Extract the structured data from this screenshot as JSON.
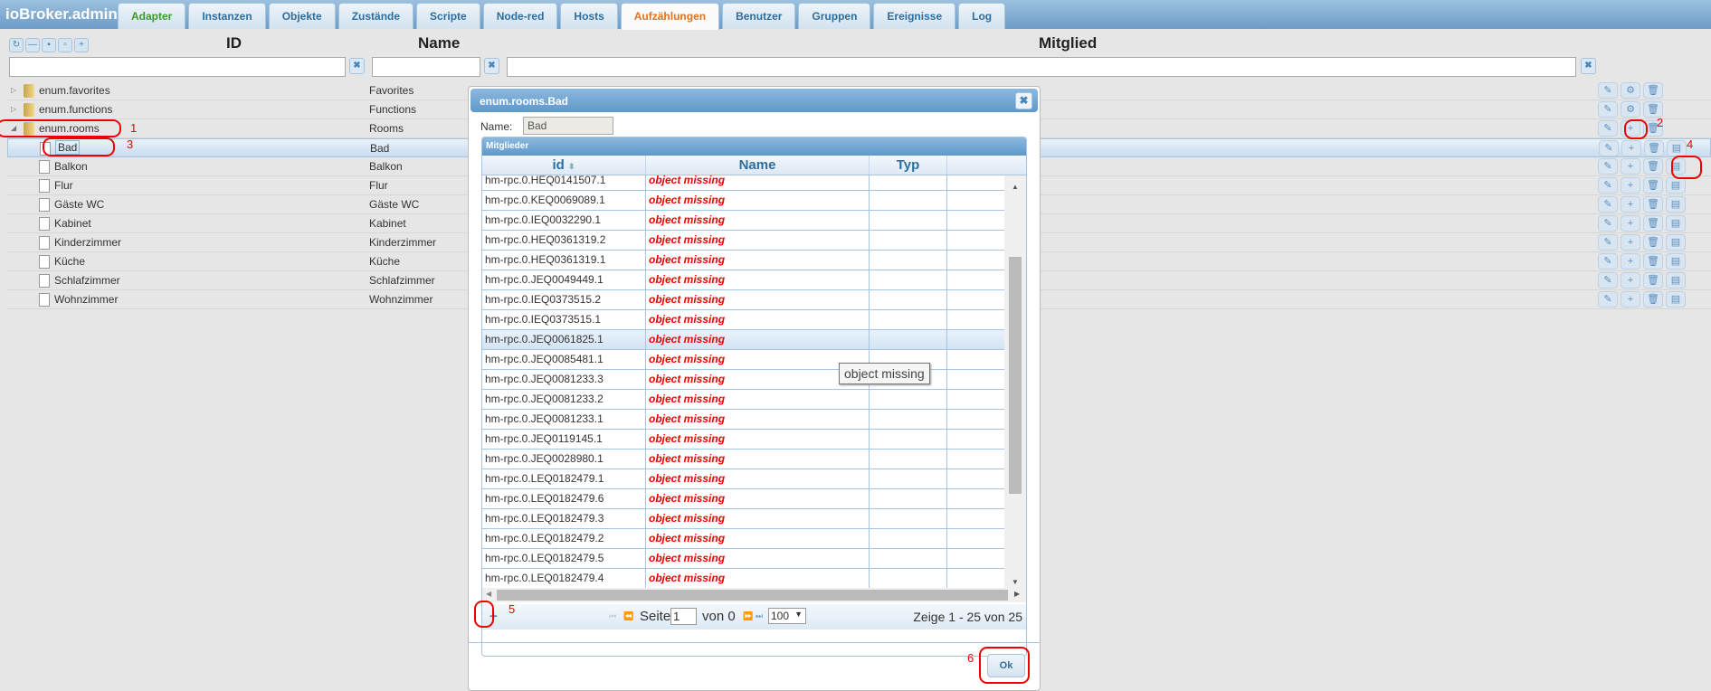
{
  "app": {
    "title": "ioBroker.admin"
  },
  "tabs": [
    "Adapter",
    "Instanzen",
    "Objekte",
    "Zustände",
    "Scripte",
    "Node-red",
    "Hosts",
    "Aufzählungen",
    "Benutzer",
    "Gruppen",
    "Ereignisse",
    "Log"
  ],
  "columns": {
    "id": "ID",
    "name": "Name",
    "members": "Mitglied"
  },
  "tree": [
    {
      "id": "enum.favorites",
      "name": "Favorites",
      "type": "folder",
      "toggle": "▷"
    },
    {
      "id": "enum.functions",
      "name": "Functions",
      "type": "folder",
      "toggle": "▷"
    },
    {
      "id": "enum.rooms",
      "name": "Rooms",
      "type": "folder",
      "toggle": "◢"
    },
    {
      "id": "Bad",
      "name": "Bad",
      "type": "file"
    },
    {
      "id": "Balkon",
      "name": "Balkon",
      "type": "file"
    },
    {
      "id": "Flur",
      "name": "Flur",
      "type": "file"
    },
    {
      "id": "Gäste WC",
      "name": "Gäste WC",
      "type": "file"
    },
    {
      "id": "Kabinet",
      "name": "Kabinet",
      "type": "file"
    },
    {
      "id": "Kinderzimmer",
      "name": "Kinderzimmer",
      "type": "file"
    },
    {
      "id": "Küche",
      "name": "Küche",
      "type": "file"
    },
    {
      "id": "Schlafzimmer",
      "name": "Schlafzimmer",
      "type": "file"
    },
    {
      "id": "Wohnzimmer",
      "name": "Wohnzimmer",
      "type": "file"
    }
  ],
  "annotations": [
    "1",
    "2",
    "3",
    "4",
    "5",
    "6"
  ],
  "dialog": {
    "title": "enum.rooms.Bad",
    "name_label": "Name:",
    "name_value": "Bad",
    "panel_title": "Mitglieder",
    "headers": {
      "id": "id",
      "name": "Name",
      "typ": "Typ"
    },
    "rows": [
      "hm-rpc.0.HEQ0141507.1",
      "hm-rpc.0.KEQ0069089.1",
      "hm-rpc.0.IEQ0032290.1",
      "hm-rpc.0.HEQ0361319.2",
      "hm-rpc.0.HEQ0361319.1",
      "hm-rpc.0.JEQ0049449.1",
      "hm-rpc.0.IEQ0373515.2",
      "hm-rpc.0.IEQ0373515.1",
      "hm-rpc.0.JEQ0061825.1",
      "hm-rpc.0.JEQ0085481.1",
      "hm-rpc.0.JEQ0081233.3",
      "hm-rpc.0.JEQ0081233.2",
      "hm-rpc.0.JEQ0081233.1",
      "hm-rpc.0.JEQ0119145.1",
      "hm-rpc.0.JEQ0028980.1",
      "hm-rpc.0.LEQ0182479.1",
      "hm-rpc.0.LEQ0182479.6",
      "hm-rpc.0.LEQ0182479.3",
      "hm-rpc.0.LEQ0182479.2",
      "hm-rpc.0.LEQ0182479.5",
      "hm-rpc.0.LEQ0182479.4"
    ],
    "missing": "object missing",
    "tooltip": "object missing",
    "pager": {
      "page_label": "Seite",
      "page": "1",
      "of_label": "von 0",
      "per_page": "100",
      "summary": "Zeige 1 - 25 von 25"
    },
    "ok": "Ok"
  }
}
